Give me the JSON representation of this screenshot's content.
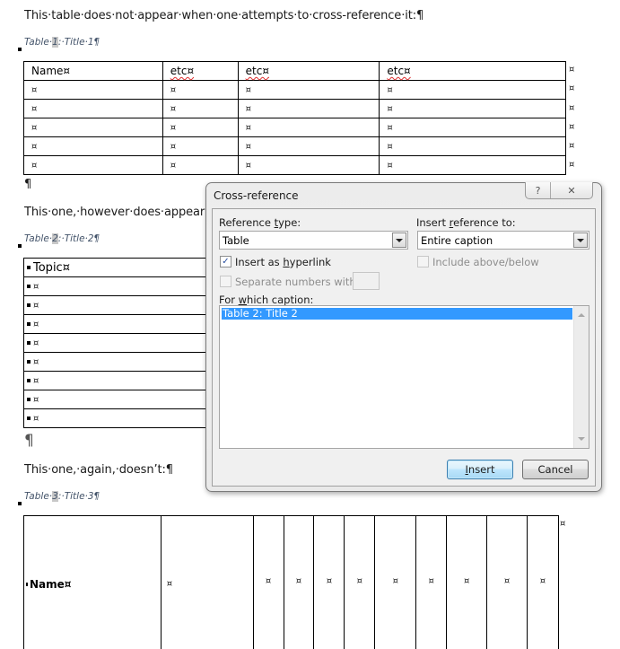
{
  "document": {
    "para1": "This·table·does·not·appear·when·one·attempts·to·cross-reference·it:¶",
    "caption1": {
      "prefix": "Table·",
      "num": "1",
      "suffix": ":·Title·1¶"
    },
    "table1": {
      "headers": [
        "Name¤",
        "etc¤",
        "etc¤",
        "etc¤"
      ],
      "cell_mark": "¤",
      "row_count": 5,
      "end_marks": [
        "¤",
        "¤",
        "¤",
        "¤",
        "¤",
        "¤"
      ]
    },
    "pilcrow1": "¶",
    "para2": "This·one,·however·does·appear:¶",
    "caption2": {
      "prefix": "Table·",
      "num": "2",
      "suffix": ":·Title·2¶"
    },
    "table2": {
      "header": "Topic¤",
      "cells": [
        "¤",
        "¤",
        "¤",
        "¤",
        "¤",
        "¤",
        "¤",
        "¤"
      ]
    },
    "pilcrow2": "¶",
    "para3": "This·one,·again,·doesn’t:¶",
    "caption3": {
      "prefix": "Table·",
      "num": "3",
      "suffix": ":·Title·3¶"
    },
    "table3": {
      "first": "Name¤",
      "cells": [
        "¤",
        "¤",
        "¤",
        "¤",
        "¤",
        "¤",
        "¤",
        "¤",
        "¤",
        "¤"
      ],
      "end_mark": "¤"
    }
  },
  "dialog": {
    "title": "Cross-reference",
    "help_icon": "question-mark-icon",
    "close_icon": "close-x-icon",
    "help_glyph": "?",
    "close_glyph": "✕",
    "reference_type": {
      "label_pre": "Reference ",
      "label_u": "t",
      "label_post": "ype:",
      "value": "Table"
    },
    "insert_reference_to": {
      "label_pre": "Insert ",
      "label_u": "r",
      "label_post": "eference to:",
      "value": "Entire caption"
    },
    "insert_as_hyperlink": {
      "label_pre": "Insert as ",
      "label_u": "h",
      "label_post": "yperlink",
      "checked": true,
      "glyph": "✓"
    },
    "include_above_below": {
      "label": "Include above/below",
      "checked": false,
      "enabled": false
    },
    "separate_numbers": {
      "label": "Separate numbers with",
      "checked": false,
      "enabled": false,
      "value": ""
    },
    "for_which_caption": {
      "label_pre": "For ",
      "label_u": "w",
      "label_post": "hich caption:"
    },
    "captions": [
      "Table 2: Title 2"
    ],
    "selected_caption": "Table 2: Title 2",
    "insert_button": {
      "u": "I",
      "rest": "nsert"
    },
    "cancel_button": "Cancel"
  }
}
